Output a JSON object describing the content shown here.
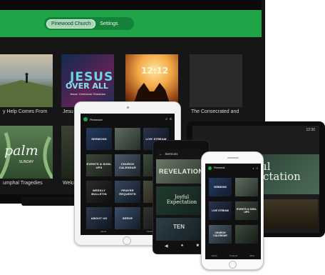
{
  "tv": {
    "tabs": [
      {
        "label": "Pinewood Church",
        "active": true
      },
      {
        "label": "Settings",
        "active": false
      }
    ],
    "tiles_row1": [
      {
        "caption": "y Help Comes From",
        "art": "hill-walker-image"
      },
      {
        "caption": "Jesu",
        "art_title": "JESUS",
        "art_sub": "OVER ALL",
        "art_note": "Jesus: Overcome Obstacles"
      },
      {
        "caption": "",
        "art_title": "12:12",
        "art": "worship-hands-image"
      },
      {
        "caption": "The Consecrated and",
        "art": "blank"
      }
    ],
    "tiles_row2": [
      {
        "caption": "umphal Tragedies",
        "art_title": "palm",
        "art_sub": "SUNDAY"
      },
      {
        "caption": "Welco",
        "art": "green-image"
      }
    ]
  },
  "tablet": {
    "app_name": "Pinewood",
    "tiles": [
      "SERMONS",
      "",
      "LIVE STREAM",
      "EVENTS & SIGN-UPS",
      "CHURCH CALENDAR",
      "",
      "WEEKLY BULLETIN",
      "PRAYER REQUESTS",
      "",
      "ABOUT US",
      "SERVE",
      ""
    ],
    "tabbar": [
      "Home",
      "Connect"
    ]
  },
  "android_tablet": {
    "status_time": "12:30",
    "hero_title": "Joyful Expectation",
    "hero_title_visible": "oyful\nxpectation"
  },
  "android_phone": {
    "header": "Sermons",
    "cards": [
      {
        "title": "REVELATION"
      },
      {
        "title": "Joyful Expectation"
      },
      {
        "title": "TEN"
      }
    ]
  },
  "iphone": {
    "app_name": "Pinewood",
    "tiles": [
      "SERMONS",
      "",
      "LIVE STREAM",
      "EVENTS & SIGN-UPS",
      "CHURCH CALENDAR",
      ""
    ],
    "tabbar": [
      "Home",
      "Connect",
      "More"
    ]
  },
  "colors": {
    "brand_green": "#1fa447",
    "tv_bg": "#161616"
  }
}
